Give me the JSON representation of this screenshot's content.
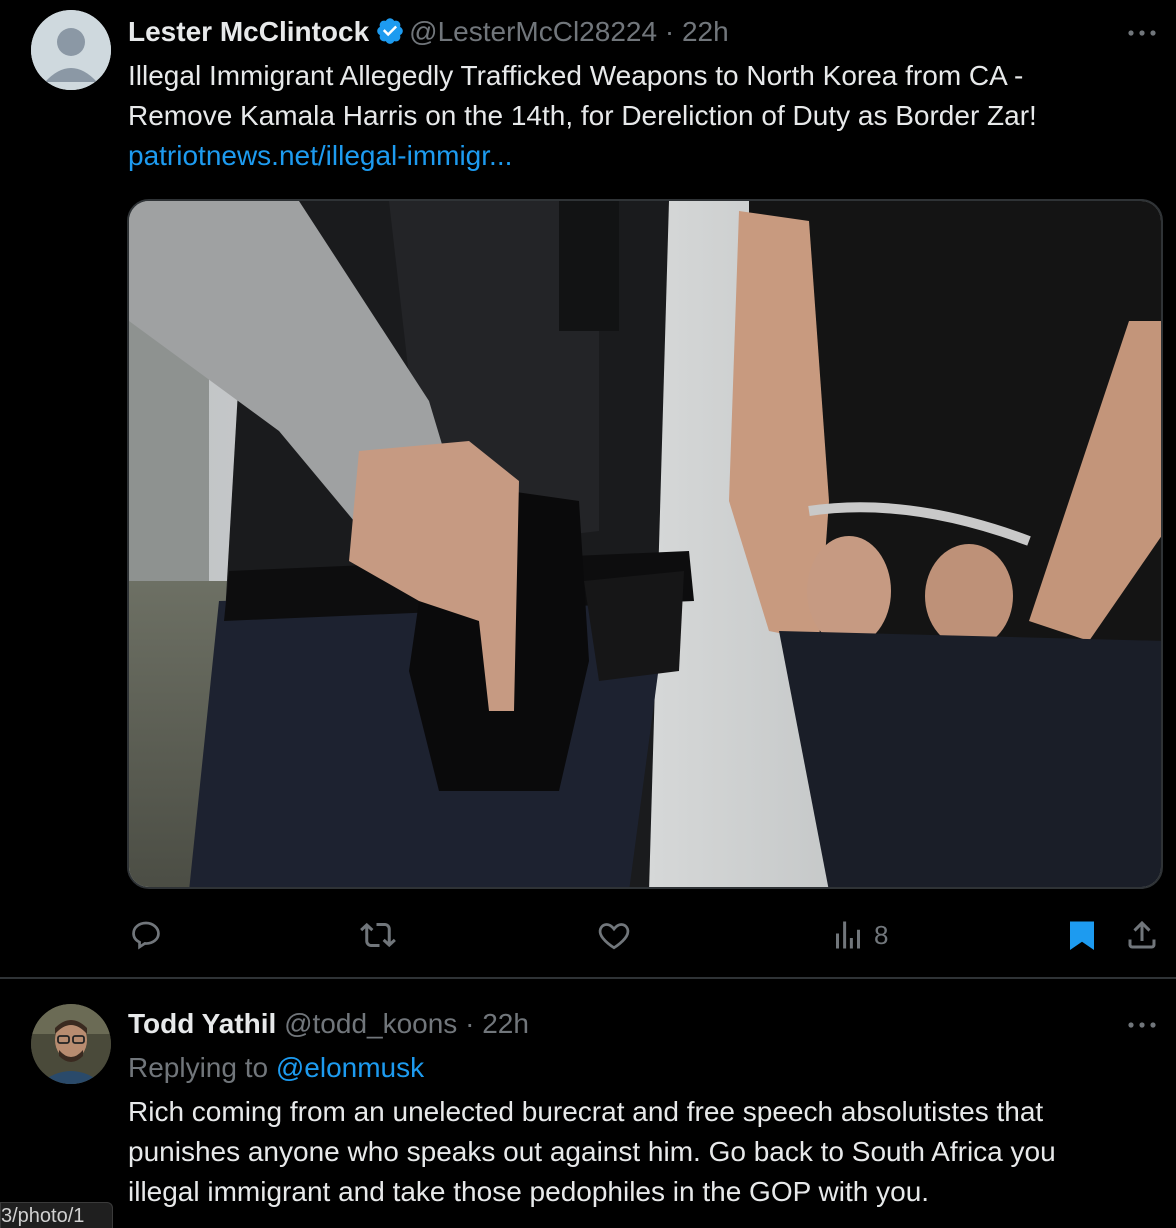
{
  "tweets": [
    {
      "name": "Lester McClintock",
      "handle": "@LesterMcCl28224",
      "separator": "·",
      "time": "22h",
      "text_line1": "Illegal Immigrant Allegedly Trafficked Weapons to North Korea from CA -",
      "text_line2": "Remove Kamala Harris on the 14th, for Dereliction of Duty as Border Zar!",
      "link": "patriotnews.net/illegal-immigr...",
      "verified": true,
      "stats": {
        "views": "8"
      }
    },
    {
      "name": "Todd Yathil",
      "handle": "@todd_koons",
      "separator": "·",
      "time": "22h",
      "replying_prefix": "Replying to",
      "replying_to": "@elonmusk",
      "text_line1": "Rich coming from an unelected burecrat and free speech absolutistes that",
      "text_line2": "punishes anyone who speaks out against him.  Go back to South Africa you",
      "text_line3": "illegal immigrant and  take those pedophiles in the GOP with you."
    }
  ],
  "status_url": "3/photo/1",
  "icons": {
    "reply": "reply-icon",
    "retweet": "retweet-icon",
    "like": "heart-icon",
    "views": "views-icon",
    "bookmark": "bookmark-icon",
    "share": "share-icon",
    "more": "more-icon",
    "verified": "verified-badge-icon"
  },
  "colors": {
    "background": "#000000",
    "text": "#e7e9ea",
    "muted": "#71767b",
    "accent": "#1d9bf0",
    "divider": "#2f3336"
  }
}
